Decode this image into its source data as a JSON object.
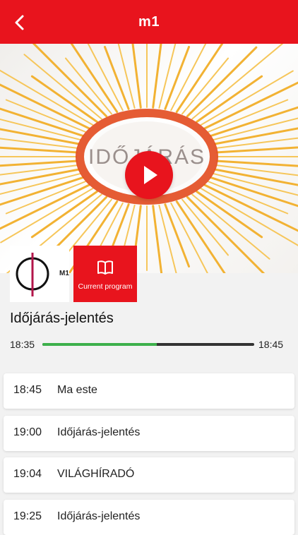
{
  "header": {
    "title": "m1",
    "back_icon": "chevron-left-icon"
  },
  "video": {
    "overlay_text": "IDŐJÁRÁS",
    "play_icon": "play-icon"
  },
  "channel": {
    "logo_text": "M1",
    "current_program_label": "Current program",
    "current_program_icon": "book-icon"
  },
  "now_playing": {
    "title": "Időjárás-jelentés",
    "start": "18:35",
    "end": "18:45",
    "progress": 0.54
  },
  "schedule": [
    {
      "time": "18:45",
      "name": "Ma este"
    },
    {
      "time": "19:00",
      "name": "Időjárás-jelentés"
    },
    {
      "time": "19:04",
      "name": "VILÁGHÍRADÓ"
    },
    {
      "time": "19:25",
      "name": "Időjárás-jelentés"
    }
  ],
  "colors": {
    "brand": "#e8141d",
    "progress": "#3db04b",
    "track": "#333333"
  }
}
